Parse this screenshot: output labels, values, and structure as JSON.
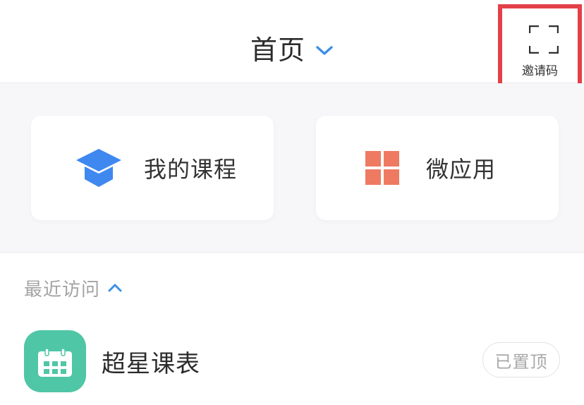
{
  "header": {
    "title": "首页",
    "invite_label": "邀请码"
  },
  "shortcuts": [
    {
      "label": "我的课程",
      "icon": "graduation-cap-icon",
      "color": "#3f88f0"
    },
    {
      "label": "微应用",
      "icon": "app-grid-icon",
      "color": "#ef7a62"
    }
  ],
  "recent": {
    "title": "最近访问",
    "items": [
      {
        "name": "超星课表",
        "badge": "已置顶",
        "icon": "calendar-icon",
        "color": "#4fc6a6"
      }
    ]
  },
  "colors": {
    "accent": "#3d8fe8",
    "highlight_border": "#e34048"
  }
}
